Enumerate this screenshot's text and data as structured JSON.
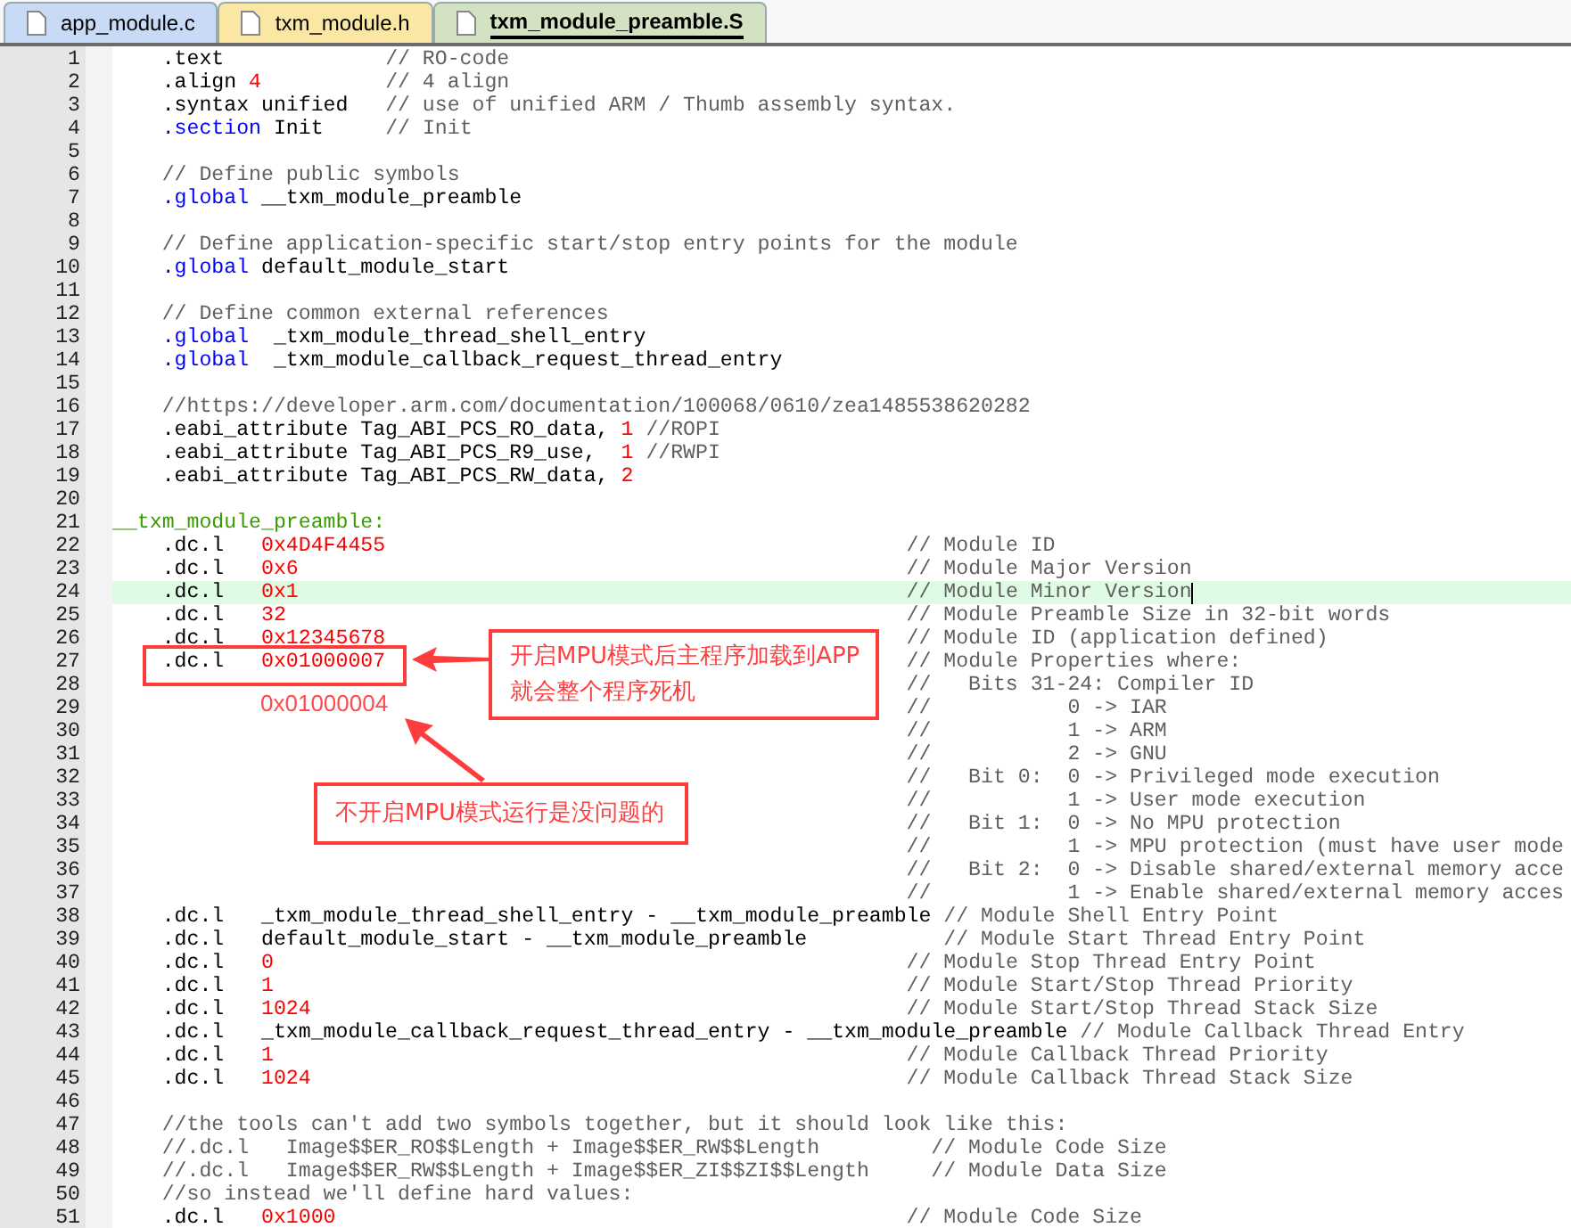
{
  "tabs": [
    {
      "label": "app_module.c",
      "selected": false,
      "color": "#c9daf6"
    },
    {
      "label": "txm_module.h",
      "selected": false,
      "color": "#fbe7a4"
    },
    {
      "label": "txm_module_preamble.S",
      "selected": true,
      "color": "#d3e2c2"
    }
  ],
  "lines": [
    {
      "number": "1",
      "current": false,
      "segments": [
        {
          "kind": "code",
          "text": "    .text"
        },
        {
          "kind": "comment",
          "text": "             // RO-code"
        }
      ]
    },
    {
      "number": "2",
      "current": false,
      "segments": [
        {
          "kind": "code",
          "text": "    .align "
        },
        {
          "kind": "number",
          "text": "4"
        },
        {
          "kind": "comment",
          "text": "          // 4 align"
        }
      ]
    },
    {
      "number": "3",
      "current": false,
      "segments": [
        {
          "kind": "code",
          "text": "    .syntax unified"
        },
        {
          "kind": "comment",
          "text": "   // use of unified ARM / Thumb assembly syntax."
        }
      ]
    },
    {
      "number": "4",
      "current": false,
      "segments": [
        {
          "kind": "keyword",
          "text": "    .section"
        },
        {
          "kind": "code",
          "text": " Init"
        },
        {
          "kind": "comment",
          "text": "     // Init"
        }
      ]
    },
    {
      "number": "5",
      "current": false
    },
    {
      "number": "6",
      "current": false,
      "segments": [
        {
          "kind": "comment",
          "text": "    // Define public symbols"
        }
      ]
    },
    {
      "number": "7",
      "current": false,
      "segments": [
        {
          "kind": "keyword",
          "text": "    .global"
        },
        {
          "kind": "code",
          "text": " __txm_module_preamble"
        }
      ]
    },
    {
      "number": "8",
      "current": false
    },
    {
      "number": "9",
      "current": false,
      "segments": [
        {
          "kind": "comment",
          "text": "    // Define application-specific start/stop entry points for the module"
        }
      ]
    },
    {
      "number": "10",
      "current": false,
      "segments": [
        {
          "kind": "keyword",
          "text": "    .global"
        },
        {
          "kind": "code",
          "text": " default_module_start"
        }
      ]
    },
    {
      "number": "11",
      "current": false
    },
    {
      "number": "12",
      "current": false,
      "segments": [
        {
          "kind": "comment",
          "text": "    // Define common external references"
        }
      ]
    },
    {
      "number": "13",
      "current": false,
      "segments": [
        {
          "kind": "keyword",
          "text": "    .global"
        },
        {
          "kind": "code",
          "text": "  _txm_module_thread_shell_entry"
        }
      ]
    },
    {
      "number": "14",
      "current": false,
      "segments": [
        {
          "kind": "keyword",
          "text": "    .global"
        },
        {
          "kind": "code",
          "text": "  _txm_module_callback_request_thread_entry"
        }
      ]
    },
    {
      "number": "15",
      "current": false
    },
    {
      "number": "16",
      "current": false,
      "segments": [
        {
          "kind": "comment",
          "text": "    //https://developer.arm.com/documentation/100068/0610/zea1485538620282"
        }
      ]
    },
    {
      "number": "17",
      "current": false,
      "segments": [
        {
          "kind": "code",
          "text": "    .eabi_attribute Tag_ABI_PCS_RO_data, "
        },
        {
          "kind": "number",
          "text": "1"
        },
        {
          "kind": "comment",
          "text": " //ROPI"
        }
      ]
    },
    {
      "number": "18",
      "current": false,
      "segments": [
        {
          "kind": "code",
          "text": "    .eabi_attribute Tag_ABI_PCS_R9_use,  "
        },
        {
          "kind": "number",
          "text": "1"
        },
        {
          "kind": "comment",
          "text": " //RWPI"
        }
      ]
    },
    {
      "number": "19",
      "current": false,
      "segments": [
        {
          "kind": "code",
          "text": "    .eabi_attribute Tag_ABI_PCS_RW_data, "
        },
        {
          "kind": "number",
          "text": "2"
        }
      ]
    },
    {
      "number": "20",
      "current": false
    },
    {
      "number": "21",
      "current": false,
      "segments": [
        {
          "kind": "label",
          "text": "__txm_module_preamble:"
        }
      ]
    },
    {
      "number": "22",
      "current": false,
      "segments": [
        {
          "kind": "code",
          "text": "    .dc.l   "
        },
        {
          "kind": "number",
          "text": "0x4D4F4455"
        },
        {
          "kind": "aligned_comment",
          "text": "// Module ID"
        }
      ]
    },
    {
      "number": "23",
      "current": false,
      "segments": [
        {
          "kind": "code",
          "text": "    .dc.l   "
        },
        {
          "kind": "number",
          "text": "0x6"
        },
        {
          "kind": "aligned_comment",
          "text": "// Module Major Version"
        }
      ]
    },
    {
      "number": "24",
      "current": true,
      "segments": [
        {
          "kind": "code",
          "text": "    .dc.l   "
        },
        {
          "kind": "number",
          "text": "0x1"
        },
        {
          "kind": "aligned_comment",
          "text": "// Module Minor Version"
        }
      ]
    },
    {
      "number": "25",
      "current": false,
      "segments": [
        {
          "kind": "code",
          "text": "    .dc.l   "
        },
        {
          "kind": "number",
          "text": "32"
        },
        {
          "kind": "aligned_comment",
          "text": "// Module Preamble Size in 32-bit words"
        }
      ]
    },
    {
      "number": "26",
      "current": false,
      "segments": [
        {
          "kind": "code",
          "text": "    .dc.l   "
        },
        {
          "kind": "number",
          "text": "0x12345678"
        },
        {
          "kind": "aligned_comment",
          "text": "// Module ID (application defined)"
        }
      ]
    },
    {
      "number": "27",
      "current": false,
      "segments": [
        {
          "kind": "code",
          "text": "    .dc.l   "
        },
        {
          "kind": "number",
          "text": "0x01000007"
        },
        {
          "kind": "aligned_comment",
          "text": "// Module Properties where:"
        }
      ]
    },
    {
      "number": "28",
      "current": false,
      "segments": [
        {
          "kind": "aligned_comment",
          "text": "//   Bits 31-24: Compiler ID"
        }
      ]
    },
    {
      "number": "29",
      "current": false,
      "segments": [
        {
          "kind": "aligned_comment",
          "text": "//           0 -> IAR"
        }
      ]
    },
    {
      "number": "30",
      "current": false,
      "segments": [
        {
          "kind": "aligned_comment",
          "text": "//           1 -> ARM"
        }
      ]
    },
    {
      "number": "31",
      "current": false,
      "segments": [
        {
          "kind": "aligned_comment",
          "text": "//           2 -> GNU"
        }
      ]
    },
    {
      "number": "32",
      "current": false,
      "segments": [
        {
          "kind": "aligned_comment",
          "text": "//   Bit 0:  0 -> Privileged mode execution"
        }
      ]
    },
    {
      "number": "33",
      "current": false,
      "segments": [
        {
          "kind": "aligned_comment",
          "text": "//           1 -> User mode execution"
        }
      ]
    },
    {
      "number": "34",
      "current": false,
      "segments": [
        {
          "kind": "aligned_comment",
          "text": "//   Bit 1:  0 -> No MPU protection"
        }
      ]
    },
    {
      "number": "35",
      "current": false,
      "segments": [
        {
          "kind": "aligned_comment",
          "text": "//           1 -> MPU protection (must have user mode"
        }
      ]
    },
    {
      "number": "36",
      "current": false,
      "segments": [
        {
          "kind": "aligned_comment",
          "text": "//   Bit 2:  0 -> Disable shared/external memory acce"
        }
      ]
    },
    {
      "number": "37",
      "current": false,
      "segments": [
        {
          "kind": "aligned_comment",
          "text": "//           1 -> Enable shared/external memory acces"
        }
      ]
    },
    {
      "number": "38",
      "current": false,
      "segments": [
        {
          "kind": "code",
          "text": "    .dc.l   _txm_module_thread_shell_entry - __txm_module_preamble"
        },
        {
          "kind": "aligned_comment",
          "text": "// Module Shell Entry Point"
        }
      ]
    },
    {
      "number": "39",
      "current": false,
      "segments": [
        {
          "kind": "code",
          "text": "    .dc.l   default_module_start - __txm_module_preamble"
        },
        {
          "kind": "comment",
          "text": "           // Module Start Thread Entry Point"
        }
      ]
    },
    {
      "number": "40",
      "current": false,
      "segments": [
        {
          "kind": "code",
          "text": "    .dc.l   "
        },
        {
          "kind": "number",
          "text": "0"
        },
        {
          "kind": "aligned_comment",
          "text": "// Module Stop Thread Entry Point"
        }
      ]
    },
    {
      "number": "41",
      "current": false,
      "segments": [
        {
          "kind": "code",
          "text": "    .dc.l   "
        },
        {
          "kind": "number",
          "text": "1"
        },
        {
          "kind": "aligned_comment",
          "text": "// Module Start/Stop Thread Priority"
        }
      ]
    },
    {
      "number": "42",
      "current": false,
      "segments": [
        {
          "kind": "code",
          "text": "    .dc.l   "
        },
        {
          "kind": "number",
          "text": "1024"
        },
        {
          "kind": "aligned_comment",
          "text": "// Module Start/Stop Thread Stack Size"
        }
      ]
    },
    {
      "number": "43",
      "current": false,
      "segments": [
        {
          "kind": "code",
          "text": "    .dc.l   _txm_module_callback_request_thread_entry - __txm_module_preamble"
        },
        {
          "kind": "aligned_comment",
          "text": "// Module Callback Thread Entry"
        }
      ]
    },
    {
      "number": "44",
      "current": false,
      "segments": [
        {
          "kind": "code",
          "text": "    .dc.l   "
        },
        {
          "kind": "number",
          "text": "1"
        },
        {
          "kind": "aligned_comment",
          "text": "// Module Callback Thread Priority"
        }
      ]
    },
    {
      "number": "45",
      "current": false,
      "segments": [
        {
          "kind": "code",
          "text": "    .dc.l   "
        },
        {
          "kind": "number",
          "text": "1024"
        },
        {
          "kind": "aligned_comment",
          "text": "// Module Callback Thread Stack Size"
        }
      ]
    },
    {
      "number": "46",
      "current": false
    },
    {
      "number": "47",
      "current": false,
      "segments": [
        {
          "kind": "comment",
          "text": "    //the tools can't add two symbols together, but it should look like this:"
        }
      ]
    },
    {
      "number": "48",
      "current": false,
      "segments": [
        {
          "kind": "comment",
          "text": "    //.dc.l   Image$$ER_RO$$Length + Image$$ER_RW$$Length         // Module Code Size"
        }
      ]
    },
    {
      "number": "49",
      "current": false,
      "segments": [
        {
          "kind": "comment",
          "text": "    //.dc.l   Image$$ER_RW$$Length + Image$$ER_ZI$$ZI$$Length     // Module Data Size"
        }
      ]
    },
    {
      "number": "50",
      "current": false,
      "segments": [
        {
          "kind": "comment",
          "text": "    //so instead we'll define hard values:"
        }
      ]
    },
    {
      "number": "51",
      "current": false,
      "segments": [
        {
          "kind": "code",
          "text": "    .dc.l   "
        },
        {
          "kind": "number",
          "text": "0x1000"
        },
        {
          "kind": "aligned_comment",
          "text": "// Module Code Size"
        }
      ]
    }
  ],
  "annotations": {
    "replacement_value": "0x01000004",
    "callouts": [
      {
        "lines": [
          "开启MPU模式后主程序加载到APP",
          "就会整个程序死机"
        ]
      },
      {
        "lines": [
          "不开启MPU模式运行是没问题的"
        ]
      }
    ]
  }
}
